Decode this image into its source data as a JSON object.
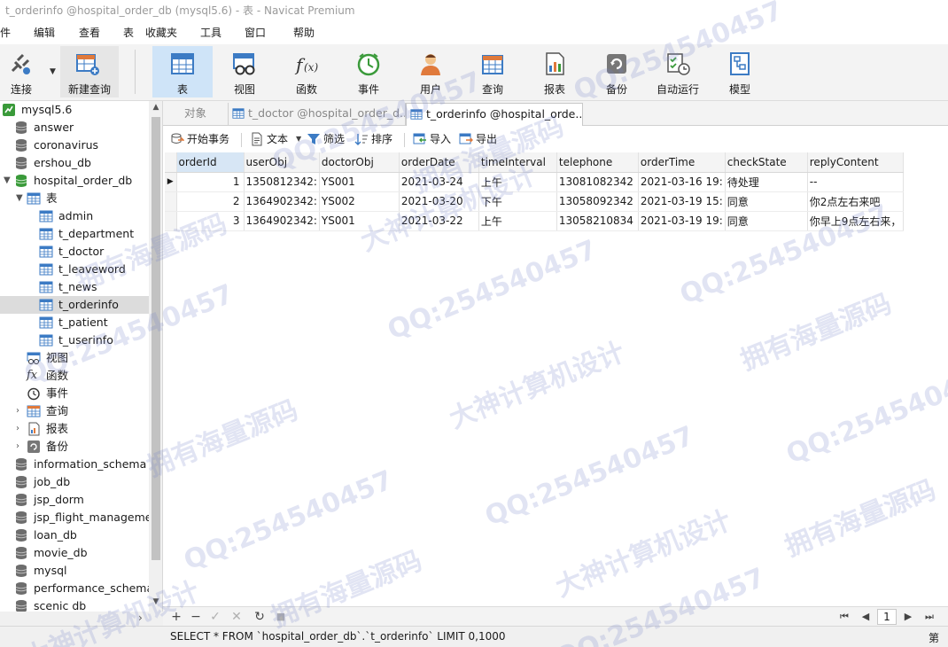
{
  "window": {
    "title": "t_orderinfo @hospital_order_db (mysql5.6) - 表 - Navicat Premium"
  },
  "menubar": {
    "items": [
      "文件",
      "编辑",
      "查看",
      "表",
      "收藏夹",
      "工具",
      "窗口",
      "帮助"
    ]
  },
  "toolbar": {
    "connect_label": "连接",
    "new_query_label": "新建查询",
    "items": [
      {
        "label": "表",
        "icon": "table-icon",
        "active": true
      },
      {
        "label": "视图",
        "icon": "view-icon"
      },
      {
        "label": "函数",
        "icon": "function-icon"
      },
      {
        "label": "事件",
        "icon": "event-clock-icon"
      },
      {
        "label": "用户",
        "icon": "user-icon"
      },
      {
        "label": "查询",
        "icon": "query-icon"
      },
      {
        "label": "报表",
        "icon": "report-icon"
      },
      {
        "label": "备份",
        "icon": "backup-icon"
      },
      {
        "label": "自动运行",
        "icon": "automation-icon"
      },
      {
        "label": "模型",
        "icon": "model-icon"
      }
    ]
  },
  "sidebar": {
    "connection": "mysql5.6",
    "databases_top": [
      "answer",
      "coronavirus",
      "ershou_db"
    ],
    "active_db": "hospital_order_db",
    "tables_group": "表",
    "tables": [
      "admin",
      "t_department",
      "t_doctor",
      "t_leaveword",
      "t_news",
      "t_orderinfo",
      "t_patient",
      "t_userinfo"
    ],
    "selected_table": "t_orderinfo",
    "groups": [
      "视图",
      "函数",
      "事件",
      "查询",
      "报表",
      "备份"
    ],
    "databases_bottom": [
      "information_schema",
      "job_db",
      "jsp_dorm",
      "jsp_flight_management",
      "loan_db",
      "movie_db",
      "mysql",
      "performance_schema",
      "scenic db"
    ]
  },
  "tabs": [
    {
      "label": "对象"
    },
    {
      "label": "t_doctor @hospital_order_d..."
    },
    {
      "label": "t_orderinfo @hospital_orde...",
      "active": true
    }
  ],
  "subtoolbar": {
    "begin_transaction": "开始事务",
    "text": "文本",
    "filter": "筛选",
    "sort": "排序",
    "import": "导入",
    "export": "导出"
  },
  "grid": {
    "columns": [
      "orderId",
      "userObj",
      "doctorObj",
      "orderDate",
      "timeInterval",
      "telephone",
      "orderTime",
      "checkState",
      "replyContent"
    ],
    "rows": [
      [
        "1",
        "1350812342:",
        "YS001",
        "2021-03-24",
        "上午",
        "13081082342",
        "2021-03-16 19:",
        "待处理",
        "--"
      ],
      [
        "2",
        "1364902342:",
        "YS002",
        "2021-03-20",
        "下午",
        "13058092342",
        "2021-03-19 15:",
        "同意",
        "你2点左右来吧"
      ],
      [
        "3",
        "1364902342:",
        "YS001",
        "2021-03-22",
        "上午",
        "13058210834",
        "2021-03-19 19:",
        "同意",
        "你早上9点左右来，"
      ]
    ]
  },
  "pager": {
    "page": "1"
  },
  "status": {
    "sql": "SELECT * FROM `hospital_order_db`.`t_orderinfo` LIMIT 0,1000",
    "right": "第"
  },
  "watermarks": [
    "QQ:254540457",
    "大神计算机设计",
    "拥有海量源码"
  ],
  "colors": {
    "accent": "#cfe4f8",
    "db_icon": "#6d6d6d",
    "table_icon": "#3c7bc4",
    "watermark": "#7882c8"
  }
}
